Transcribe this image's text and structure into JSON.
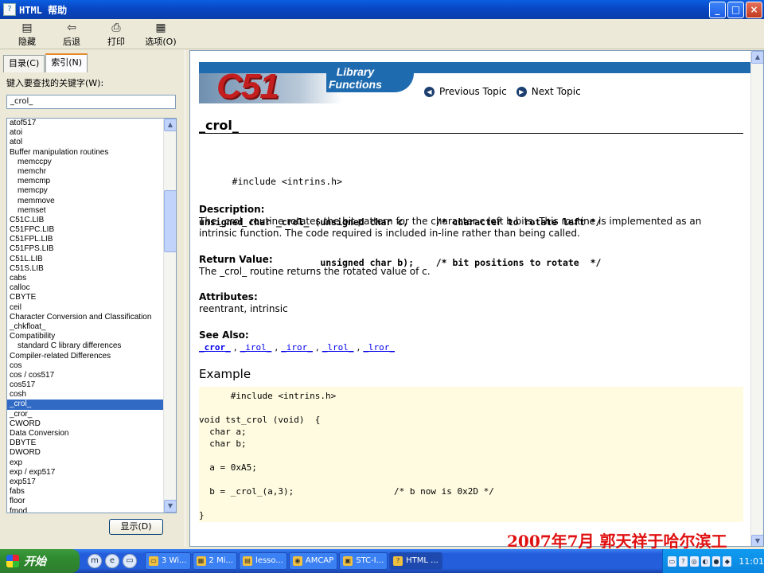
{
  "window": {
    "title": "HTML 帮助",
    "buttons": [
      "_",
      "□",
      "×"
    ]
  },
  "toolbar": {
    "items": [
      {
        "label": "隐藏",
        "icon": "hide-icon"
      },
      {
        "label": "后退",
        "icon": "back-arrow-icon"
      },
      {
        "label": "打印",
        "icon": "printer-icon"
      },
      {
        "label": "选项(O)",
        "icon": "options-icon"
      }
    ]
  },
  "left": {
    "tabs": [
      {
        "label": "目录(C)",
        "active": false
      },
      {
        "label": "索引(N)",
        "active": true
      }
    ],
    "keyword_label": "键入要查找的关键字(W):",
    "keyword_value": "_crol_",
    "items": [
      {
        "text": "atof517",
        "indent": false
      },
      {
        "text": "atoi",
        "indent": false
      },
      {
        "text": "atol",
        "indent": false
      },
      {
        "text": "Buffer manipulation routines",
        "indent": false
      },
      {
        "text": "memccpy",
        "indent": true
      },
      {
        "text": "memchr",
        "indent": true
      },
      {
        "text": "memcmp",
        "indent": true
      },
      {
        "text": "memcpy",
        "indent": true
      },
      {
        "text": "memmove",
        "indent": true
      },
      {
        "text": "memset",
        "indent": true
      },
      {
        "text": "C51C.LIB",
        "indent": false
      },
      {
        "text": "C51FPC.LIB",
        "indent": false
      },
      {
        "text": "C51FPL.LIB",
        "indent": false
      },
      {
        "text": "C51FPS.LIB",
        "indent": false
      },
      {
        "text": "C51L.LIB",
        "indent": false
      },
      {
        "text": "C51S.LIB",
        "indent": false
      },
      {
        "text": "cabs",
        "indent": false
      },
      {
        "text": "calloc",
        "indent": false
      },
      {
        "text": "CBYTE",
        "indent": false
      },
      {
        "text": "ceil",
        "indent": false
      },
      {
        "text": "Character Conversion and Classification",
        "indent": false
      },
      {
        "text": "_chkfloat_",
        "indent": false
      },
      {
        "text": "Compatibility",
        "indent": false
      },
      {
        "text": "standard C library differences",
        "indent": true
      },
      {
        "text": "Compiler-related Differences",
        "indent": false
      },
      {
        "text": "cos",
        "indent": false
      },
      {
        "text": "cos / cos517",
        "indent": false
      },
      {
        "text": "cos517",
        "indent": false
      },
      {
        "text": "cosh",
        "indent": false
      },
      {
        "text": "_crol_",
        "indent": false,
        "selected": true
      },
      {
        "text": "_cror_",
        "indent": false
      },
      {
        "text": "CWORD",
        "indent": false
      },
      {
        "text": "Data Conversion",
        "indent": false
      },
      {
        "text": "DBYTE",
        "indent": false
      },
      {
        "text": "DWORD",
        "indent": false
      },
      {
        "text": "exp",
        "indent": false
      },
      {
        "text": "exp / exp517",
        "indent": false
      },
      {
        "text": "exp517",
        "indent": false
      },
      {
        "text": "fabs",
        "indent": false
      },
      {
        "text": "floor",
        "indent": false
      },
      {
        "text": "fmod",
        "indent": false
      }
    ],
    "show_button": "显示(D)"
  },
  "content": {
    "banner": {
      "logo": "C51",
      "subtitle_line1": "Library",
      "subtitle_line2": "Functions",
      "prev": "Previous Topic",
      "next": "Next Topic"
    },
    "heading": "_crol_",
    "code_lines": [
      "      #include <intrins.h>",
      "unsigned char _crol_ (unsigned char c,     /* character to rotate left */",
      "                      unsigned char b);    /* bit positions to rotate  */"
    ],
    "description_title": "Description:",
    "description_text": "The _crol_ routine rotates the bit pattern for the character c left b bits. This routine is implemented as an intrinsic function. The code required is included in-line rather than being called.",
    "return_title": "Return Value:",
    "return_text": "The _crol_ routine returns the rotated value of c.",
    "attributes_title": "Attributes:",
    "attributes_text": "reentrant, intrinsic",
    "seealso_title": "See Also:",
    "seealso_links": [
      "_cror_",
      "_irol_",
      "_iror_",
      "_lrol_",
      "_lror_"
    ],
    "example_title": "Example",
    "example_code": "      #include <intrins.h>\n\nvoid tst_crol (void)  {\n  char a;\n  char b;\n\n  a = 0xA5;\n\n  b = _crol_(a,3);                   /* b now is 0x2D */\n\n}"
  },
  "watermark": "2007年7月  郭天祥于哈尔滨工",
  "taskbar": {
    "start": "开始",
    "tasks": [
      "3 Wi...",
      "2 Mi...",
      "lesso...",
      "AMCAP",
      "STC-I...",
      "HTML ..."
    ],
    "clock": "11:01"
  }
}
